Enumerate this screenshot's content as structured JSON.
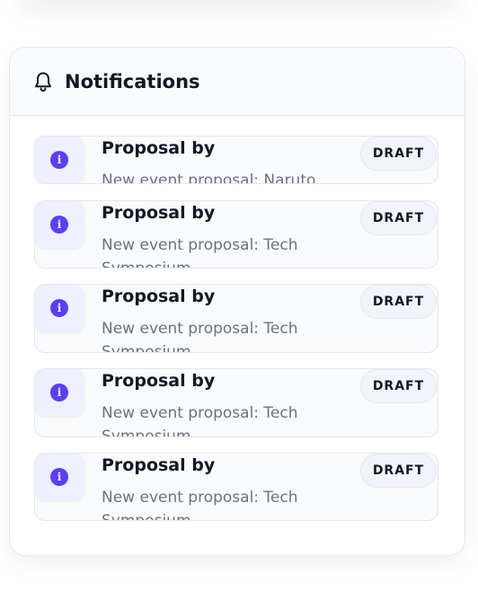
{
  "panel": {
    "title": "Notifications",
    "header_icon": "bell-icon"
  },
  "notifications": [
    {
      "title": "Proposal by",
      "message": "New event proposal: Naruto",
      "badge": "DRAFT",
      "icon": "info-icon"
    },
    {
      "title": "Proposal by",
      "message": "New event proposal: Tech Symposium",
      "badge": "DRAFT",
      "icon": "info-icon"
    },
    {
      "title": "Proposal by",
      "message": "New event proposal: Tech Symposium",
      "badge": "DRAFT",
      "icon": "info-icon"
    },
    {
      "title": "Proposal by",
      "message": "New event proposal: Tech Symposium",
      "badge": "DRAFT",
      "icon": "info-icon"
    },
    {
      "title": "Proposal by",
      "message": "New event proposal: Tech Symposium",
      "badge": "DRAFT",
      "icon": "info-icon"
    }
  ],
  "colors": {
    "accent": "#5b3ff2",
    "icon_bg": "#eef0ff",
    "card_bg": "#f9fafb",
    "border": "#e2e8f0"
  }
}
